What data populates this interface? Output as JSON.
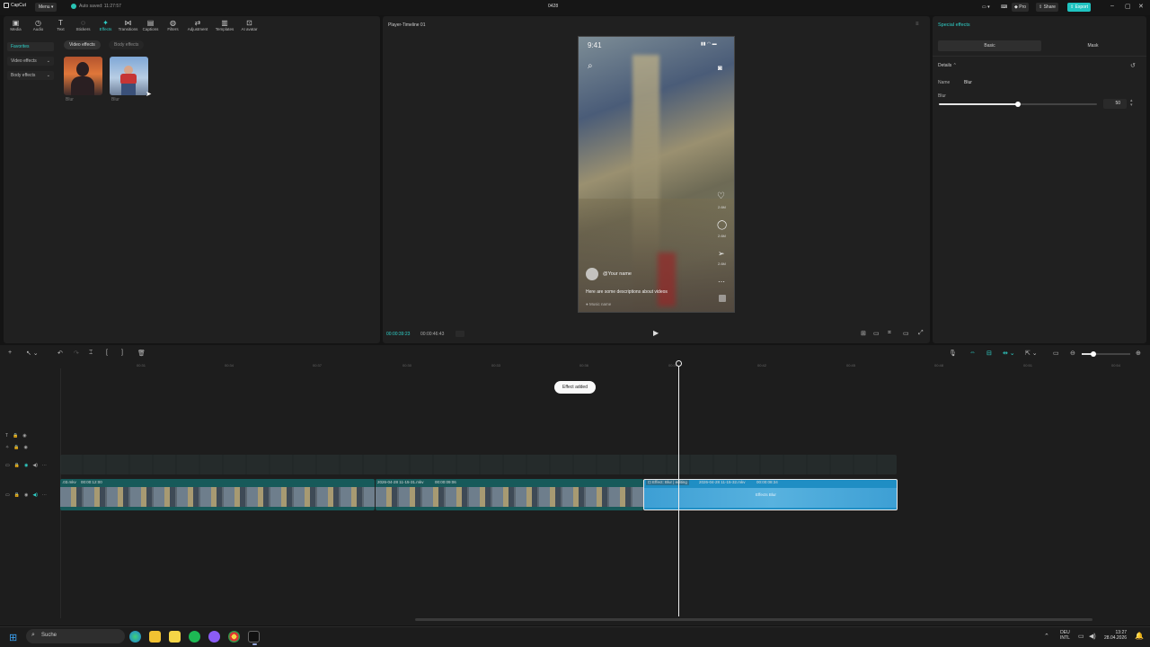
{
  "titlebar": {
    "app_name": "CapCut",
    "menu_label": "Menu",
    "autosave_text": "Auto saved: 11:27:57",
    "project_title": "0428",
    "pro_label": "Pro",
    "share_label": "Share",
    "export_label": "Export"
  },
  "toolbar": {
    "tabs": [
      {
        "label": "Media",
        "icon": "media-icon"
      },
      {
        "label": "Audio",
        "icon": "audio-icon"
      },
      {
        "label": "Text",
        "icon": "text-icon"
      },
      {
        "label": "Stickers",
        "icon": "stickers-icon"
      },
      {
        "label": "Effects",
        "icon": "effects-icon"
      },
      {
        "label": "Transitions",
        "icon": "transitions-icon"
      },
      {
        "label": "Captions",
        "icon": "captions-icon"
      },
      {
        "label": "Filters",
        "icon": "filters-icon"
      },
      {
        "label": "Adjustment",
        "icon": "adjustment-icon"
      },
      {
        "label": "Templates",
        "icon": "templates-icon"
      },
      {
        "label": "AI avatar",
        "icon": "ai-avatar-icon"
      }
    ]
  },
  "sidebar": {
    "favorites": "Favorites",
    "video_effects": "Video effects",
    "body_effects": "Body effects"
  },
  "effects_browser": {
    "pill_video": "Video effects",
    "pill_body": "Body effects",
    "items": [
      {
        "label": "Blur"
      },
      {
        "label": "Blur"
      }
    ]
  },
  "player": {
    "title": "Player-Timeline 01",
    "current_time": "00:00:39:23",
    "total_time": "00:00:46:43",
    "phone": {
      "clock": "9:41",
      "username": "@Your name",
      "description": "Here are some descriptions about videos",
      "music": "Music name",
      "likes": "2.6M",
      "comments": "2.6M",
      "shares": "2.6M"
    }
  },
  "inspector": {
    "title": "Special effects",
    "tab_basic": "Basic",
    "tab_mask": "Mask",
    "details_label": "Details",
    "name_label": "Name",
    "name_value": "Blur",
    "blur_label": "Blur",
    "blur_value": "50",
    "blur_level": 0.5
  },
  "timeline": {
    "ruler": [
      "00:31",
      "00:34",
      "00:37",
      "00:30",
      "00:33",
      "00:36",
      "00:39",
      "00:42",
      "00:45",
      "00:48",
      "00:51",
      "00:54"
    ],
    "toast": "Effect added",
    "clips": {
      "clip1_name": ".03.mkv",
      "clip1_duration": "00:00:12:00",
      "clip2_name": "2026-04-28 11-15-31.mkv",
      "clip2_duration": "00:00:09:06",
      "effect_tag": "Effect: Blur | editing",
      "clip3_name": "2026-04-28 11-15-32.mkv",
      "clip3_duration": "00:00:08:34",
      "clip3_center": "Effects   Blur"
    }
  },
  "taskbar": {
    "search": "Suche",
    "lang_top": "DEU",
    "lang_bottom": "INTL",
    "time": "13:27",
    "date": "28.04.2026"
  }
}
